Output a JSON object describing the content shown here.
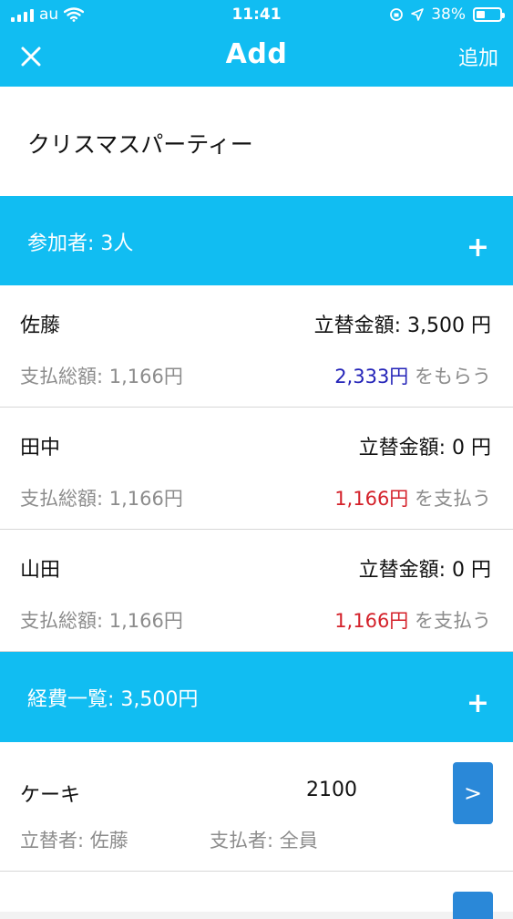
{
  "status_bar": {
    "carrier": "au",
    "time": "11:41",
    "battery": "38%",
    "battery_level": 0.38
  },
  "nav": {
    "title": "Add",
    "add_label": "追加",
    "close_icon": "close-icon"
  },
  "event": {
    "name": "クリスマスパーティー"
  },
  "participants_section": {
    "label": "参加者: 3人",
    "add_symbol": "+"
  },
  "participants": [
    {
      "name": "佐藤",
      "advance": "立替金額: 3,500 円",
      "paid_total": "支払総額: 1,166円",
      "settle_amount": "2,333円",
      "settle_text": " をもらう",
      "settle_type": "receive"
    },
    {
      "name": "田中",
      "advance": "立替金額: 0 円",
      "paid_total": "支払総額: 1,166円",
      "settle_amount": "1,166円",
      "settle_text": " を支払う",
      "settle_type": "pay"
    },
    {
      "name": "山田",
      "advance": "立替金額: 0 円",
      "paid_total": "支払総額: 1,166円",
      "settle_amount": "1,166円",
      "settle_text": " を支払う",
      "settle_type": "pay"
    }
  ],
  "expenses_section": {
    "label": "経費一覧: 3,500円",
    "add_symbol": "+"
  },
  "expenses": [
    {
      "name": "ケーキ",
      "amount": "2100",
      "payer": "立替者: 佐藤",
      "payees": "支払者: 全員",
      "detail_label": ">"
    }
  ],
  "colors": {
    "header": "#11bdf2",
    "receive": "#2323b8",
    "pay": "#d4212a",
    "button": "#2a88d8"
  }
}
